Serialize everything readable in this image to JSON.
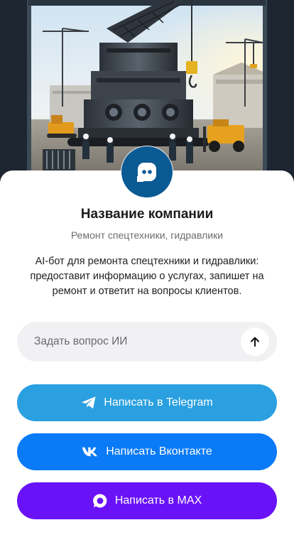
{
  "hero": {
    "image_name": "industrial-equipment-repair-illustration"
  },
  "company": {
    "name": "Название компании",
    "subtitle": "Ремонт спецтехники, гидравлики",
    "description": "AI-бот для ремонта спецтехники и гидравлики: предоставит информацию о услугах, запишет на ремонт и ответит на вопросы клиентов.",
    "avatar_icon": "chat-bot-icon",
    "avatar_color": "#0a5a94"
  },
  "ask": {
    "placeholder": "Задать вопрос ИИ",
    "value": "",
    "send_icon": "arrow-up-icon"
  },
  "buttons": {
    "telegram": {
      "label": "Написать в Telegram",
      "icon": "telegram-icon",
      "color": "#2aa0e0"
    },
    "vk": {
      "label": "Написать Вконтакте",
      "icon": "vk-icon",
      "color": "#0a7af7"
    },
    "max": {
      "label": "Написать в MAX",
      "icon": "max-icon",
      "color": "#6a12f7"
    }
  }
}
